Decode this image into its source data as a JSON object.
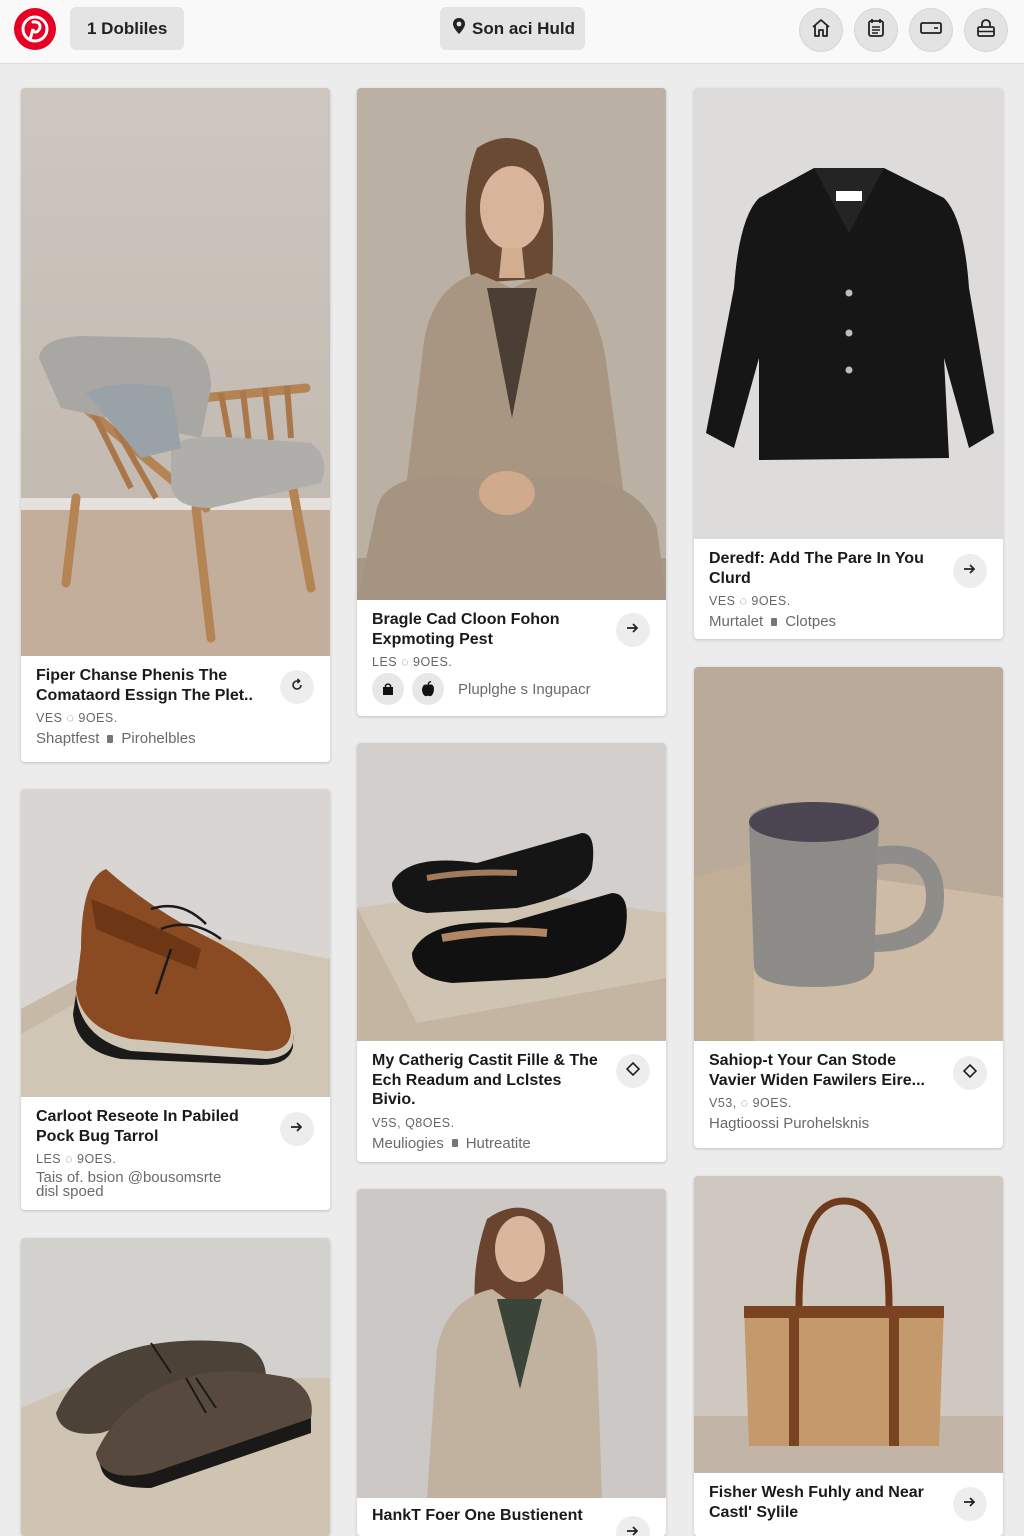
{
  "header": {
    "logo_icon": "pinterest-logo",
    "filter_label": "1 Dobliles",
    "location_label": "Son aci Huld",
    "nav_icons": [
      "home-icon",
      "calendar-icon",
      "card-icon",
      "profile-lock-icon"
    ],
    "brand_color": "#e60023"
  },
  "pins": [
    {
      "title": "Fiper Chanse Phenis The Comataord Essign The Plet..",
      "meta": "VES  ◌ 9OES.",
      "source": "Shaptfest",
      "source2": "Pirohelbles",
      "image": "chair"
    },
    {
      "title": "Bragle Cad Cloon Fohon Expmoting Pest",
      "meta": "LES  ◌ 9OES.",
      "source": "Pluplghe s Ingupacr",
      "image": "woman-coat"
    },
    {
      "title": "Deredf: Add The Pare In You Clurd",
      "meta": "VES  ◌ 9OES.",
      "source": "Murtalet",
      "source2": "Clotpes",
      "image": "jacket"
    },
    {
      "title": "Carloot Reseote In Pabiled Pock Bug Tarrol",
      "meta": "LES  ◌ 9OES.",
      "source": "Tais of. bsion @bousomsrte",
      "source_line2": "disl spoed",
      "image": "brown-shoe"
    },
    {
      "title": "My Catherig Castit Fille & The Ech Readum and Lclstes Bivio.",
      "meta": "V5S,  Q8OES.",
      "source": "Meuliogies",
      "source2": "Hutreatite",
      "image": "flats"
    },
    {
      "title": "Sahiop-t Your Can Stode Vavier Widen Fawilers Eire...",
      "meta": "V53,  ◌ 9OES.",
      "source": "Hagtioossi Purohelsknis",
      "image": "mug"
    },
    {
      "title": "",
      "image": "oxfords"
    },
    {
      "title": "HankT Foer One Bustienent",
      "image": "woman-portrait"
    },
    {
      "title": "Fisher Wesh Fuhly and Near Castl' Sylile",
      "image": "tote"
    }
  ]
}
